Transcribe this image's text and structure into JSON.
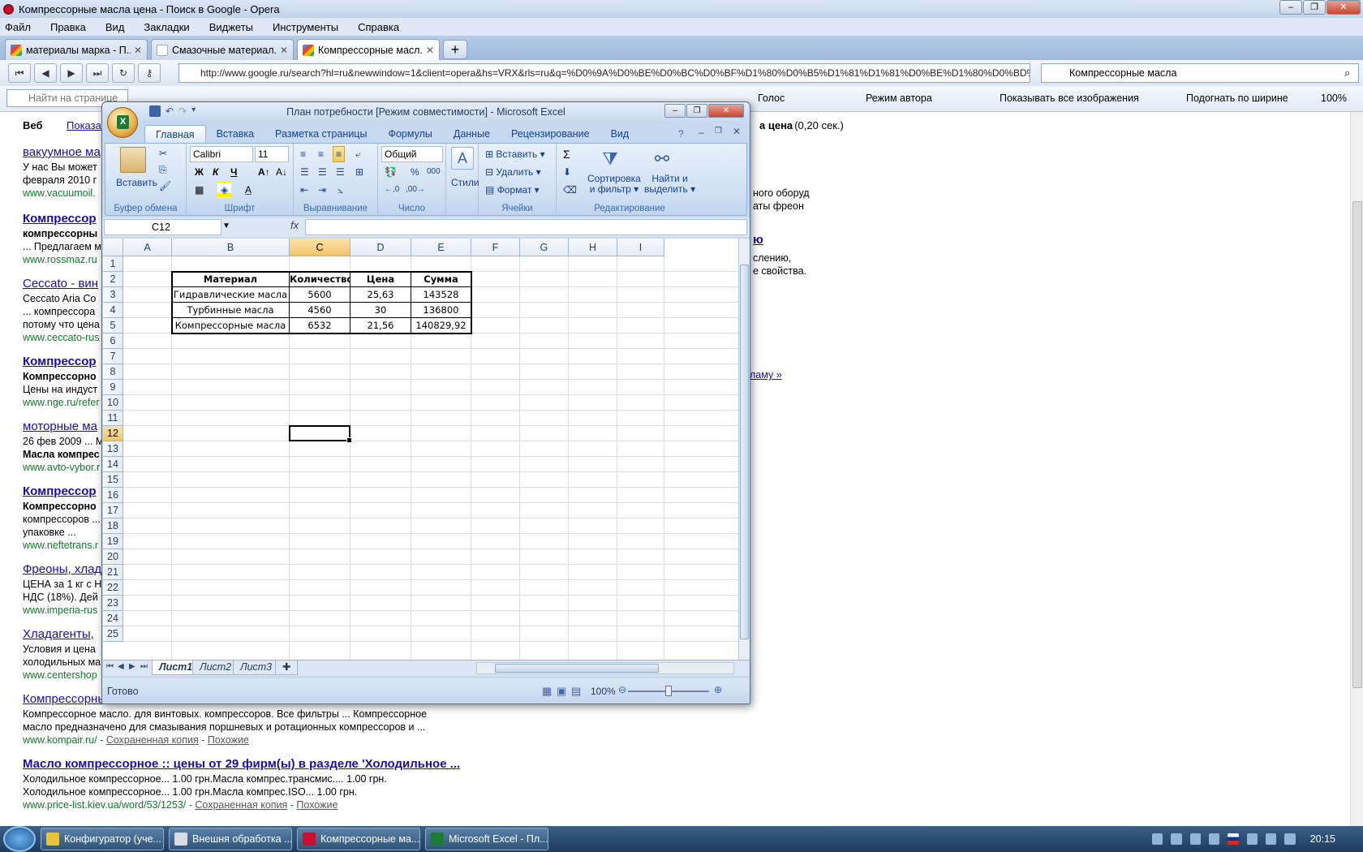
{
  "opera": {
    "title": "Компрессорные масла цена - Поиск в Google - Opera",
    "menu": [
      "Файл",
      "Правка",
      "Вид",
      "Закладки",
      "Виджеты",
      "Инструменты",
      "Справка"
    ],
    "tabs": [
      {
        "label": "материалы марка - П...",
        "active": false
      },
      {
        "label": "Смазочные материал...",
        "active": false
      },
      {
        "label": "Компрессорные масл...",
        "active": true
      }
    ],
    "url": "http://www.google.ru/search?hl=ru&newwindow=1&client=opera&hs=VRX&rls=ru&q=%D0%9A%D0%BE%D0%BC%D0%BF%D1%80%D0%B5%D1%81%D1%81%D0%BE%D1%80%D0%BD%D1%8B%D0",
    "search_value": "Компрессорные масла",
    "find_placeholder": "Найти на странице",
    "bar2": {
      "voice": "Голос",
      "author_mode": "Режим автора",
      "show_images": "Показывать все изображения",
      "fit_width": "Подогнать по ширине",
      "zoom": "100%"
    }
  },
  "google": {
    "web": "Веб",
    "show": "Показа",
    "stats_tail": "а цена",
    "stats_time": ". (0,20 сек.)",
    "results": [
      {
        "title": "вакуумное ма",
        "lines": [
          "У нас Вы может",
          "февраля 2010 г"
        ],
        "url": "www.vacuumoil."
      },
      {
        "title": "Компрессор",
        "lines": [
          "компрессорны",
          "... Предлагаем м"
        ],
        "url": "www.rossmaz.ru"
      },
      {
        "title": "Ceccato - вин",
        "lines": [
          "Ceccato Aria Co",
          "... компрессора",
          "потому что цена"
        ],
        "url": "www.ceccato-rus"
      },
      {
        "title": "Компрессор",
        "lines": [
          "Компрессорно",
          "Цены на индуст"
        ],
        "url": "www.nge.ru/refer"
      },
      {
        "title": "моторные ма",
        "lines": [
          "26 фев 2009 ... М",
          "Масла компрес"
        ],
        "url": "www.avto-vybor.r"
      },
      {
        "title": "Компрессор",
        "lines": [
          "Компрессорно",
          "компрессоров ...",
          "упаковке ..."
        ],
        "url": "www.neftetrans.r"
      },
      {
        "title": "Фреоны, хлад",
        "lines": [
          "ЦЕНА за 1 кг с Н",
          "НДС (18%). Дей"
        ],
        "url": "www.imperia-rus"
      },
      {
        "title": "Хладагенты,",
        "lines": [
          "Условия и цена",
          "холодильных ма"
        ],
        "url": "www.centershop"
      },
      {
        "title": "Компрессорны",
        "lines": [
          "Компрессорное масло. для винтовых. компрессоров. Все фильтры ... Компрессорное",
          "масло предназначено для смазывания поршневых и ротационных компрессоров и ..."
        ],
        "url": "www.kompair.ru/",
        "cache": "Сохраненная копия",
        "similar": "Похожие"
      },
      {
        "title": "Масло компрессорное :: цены от 29 фирм(ы) в разделе 'Холодильное ...",
        "lines": [
          "Холодильное компрессорное... 1.00 грн.Масла компрес.трансмис.... 1.00 грн.",
          "Холодильное компрессорное... 1.00 грн.Масла компрес.ISO... 1.00 грн."
        ],
        "url": "www.price-list.kiev.ua/word/53/1253/",
        "cache": "Сохраненная копия",
        "similar": "Похожие"
      }
    ],
    "right_fragments": [
      "ного оборуд",
      "аты фреон",
      "ю",
      "слению,",
      "е свойства.",
      "ламу »"
    ]
  },
  "excel": {
    "title": "План потребности  [Режим совместимости]  -  Microsoft Excel",
    "orb_letter": "X",
    "ribbon_tabs": [
      "Главная",
      "Вставка",
      "Разметка страницы",
      "Формулы",
      "Данные",
      "Рецензирование",
      "Вид"
    ],
    "ribbon": {
      "paste": "Вставить",
      "clipboard": "Буфер обмена",
      "font_name": "Calibri",
      "font_size": "11",
      "font_group": "Шрифт",
      "bold": "Ж",
      "italic": "К",
      "underline": "Ч",
      "alignment": "Выравнивание",
      "number_format": "Общий",
      "percent": "%",
      "thousands": "000",
      "number_group": "Число",
      "styles": "Стили",
      "insert": "Вставить",
      "delete": "Удалить",
      "format": "Формат",
      "cells_group": "Ячейки",
      "sigma": "Σ",
      "sort_l1": "Сортировка",
      "sort_l2": "и фильтр",
      "find_l1": "Найти и",
      "find_l2": "выделить",
      "editing_group": "Редактирование"
    },
    "name_box": "C12",
    "fx": "fx",
    "columns": [
      "A",
      "B",
      "C",
      "D",
      "E",
      "F",
      "G",
      "H",
      "I"
    ],
    "rows": [
      "1",
      "2",
      "3",
      "4",
      "5",
      "6",
      "7",
      "8",
      "9",
      "10",
      "11",
      "12",
      "13",
      "14",
      "15",
      "16",
      "17",
      "18",
      "19",
      "20",
      "21",
      "22",
      "23",
      "24",
      "25"
    ],
    "selected_column": "C",
    "selected_row": "12",
    "table": {
      "headers": [
        "Материал",
        "Количество",
        "Цена",
        "Сумма"
      ],
      "rows": [
        [
          "Гидравлические масла",
          "5600",
          "25,63",
          "143528"
        ],
        [
          "Турбинные масла",
          "4560",
          "30",
          "136800"
        ],
        [
          "Компрессорные масла",
          "6532",
          "21,56",
          "140829,92"
        ]
      ]
    },
    "sheets": [
      "Лист1",
      "Лист2",
      "Лист3"
    ],
    "active_sheet": "Лист1",
    "status": "Готово",
    "zoom": "100%"
  },
  "taskbar": {
    "items": [
      {
        "label": "Конфигуратор (уче...",
        "color": "#e9c33a"
      },
      {
        "label": "Внешня обработка ...",
        "color": "#d9dde3"
      },
      {
        "label": "Компрессорные ма...",
        "color": "#c8102e"
      },
      {
        "label": "Microsoft Excel - Пл...",
        "color": "#1e7b34"
      }
    ],
    "clock": "20:15"
  }
}
